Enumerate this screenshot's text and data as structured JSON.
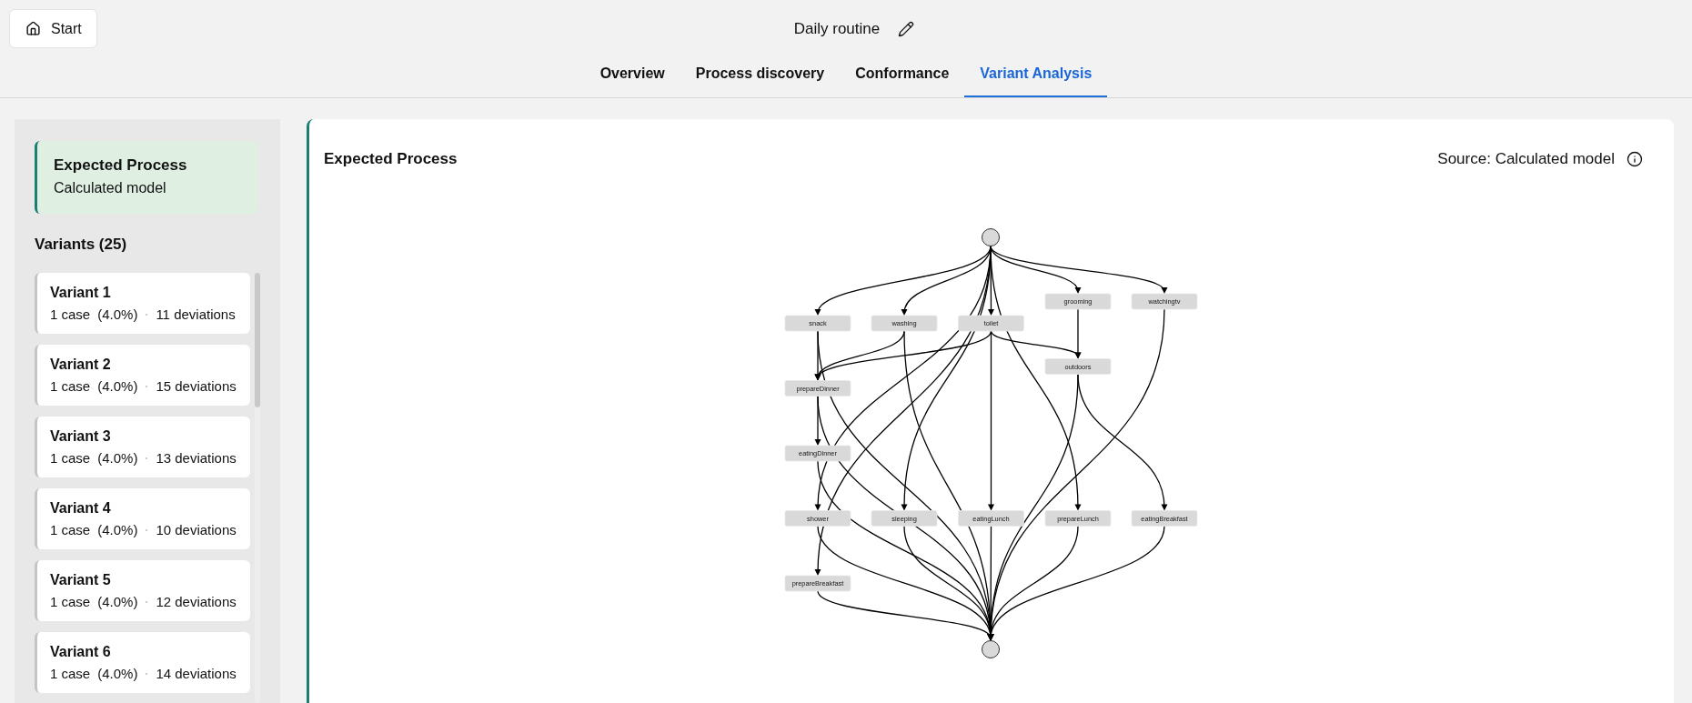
{
  "header": {
    "home_button": "Start",
    "title": "Daily routine"
  },
  "tabs": [
    {
      "label": "Overview",
      "selected": false
    },
    {
      "label": "Process discovery",
      "selected": false
    },
    {
      "label": "Conformance",
      "selected": false
    },
    {
      "label": "Variant Analysis",
      "selected": true
    }
  ],
  "sidebar": {
    "expected_process": {
      "title": "Expected Process",
      "subtitle": "Calculated model",
      "selected": true
    },
    "variants_heading": "Variants (25)",
    "variants": [
      {
        "title": "Variant 1",
        "cases": "1 case",
        "share": "(4.0%)",
        "deviations": "11 deviations",
        "selected": false
      },
      {
        "title": "Variant 2",
        "cases": "1 case",
        "share": "(4.0%)",
        "deviations": "15 deviations",
        "selected": false
      },
      {
        "title": "Variant 3",
        "cases": "1 case",
        "share": "(4.0%)",
        "deviations": "13 deviations",
        "selected": false
      },
      {
        "title": "Variant 4",
        "cases": "1 case",
        "share": "(4.0%)",
        "deviations": "10 deviations",
        "selected": false
      },
      {
        "title": "Variant 5",
        "cases": "1 case",
        "share": "(4.0%)",
        "deviations": "12 deviations",
        "selected": false
      },
      {
        "title": "Variant 6",
        "cases": "1 case",
        "share": "(4.0%)",
        "deviations": "14 deviations",
        "selected": false
      }
    ]
  },
  "main": {
    "title": "Expected Process",
    "source": "Source: Calculated model",
    "process_model": {
      "nodes": [
        {
          "kind": "start"
        },
        {
          "kind": "activity",
          "label": "snack"
        },
        {
          "kind": "activity",
          "label": "washing"
        },
        {
          "kind": "activity",
          "label": "toilet"
        },
        {
          "kind": "activity",
          "label": "grooming"
        },
        {
          "kind": "activity",
          "label": "watchingtv"
        },
        {
          "kind": "activity",
          "label": "outdoors"
        },
        {
          "kind": "activity",
          "label": "prepareDinner"
        },
        {
          "kind": "activity",
          "label": "eatingDinner"
        },
        {
          "kind": "activity",
          "label": "shower"
        },
        {
          "kind": "activity",
          "label": "sleeping"
        },
        {
          "kind": "activity",
          "label": "eatingLunch"
        },
        {
          "kind": "activity",
          "label": "prepareLunch"
        },
        {
          "kind": "activity",
          "label": "eatingBreakfast"
        },
        {
          "kind": "activity",
          "label": "prepareBreakfast"
        },
        {
          "kind": "end"
        }
      ]
    }
  }
}
